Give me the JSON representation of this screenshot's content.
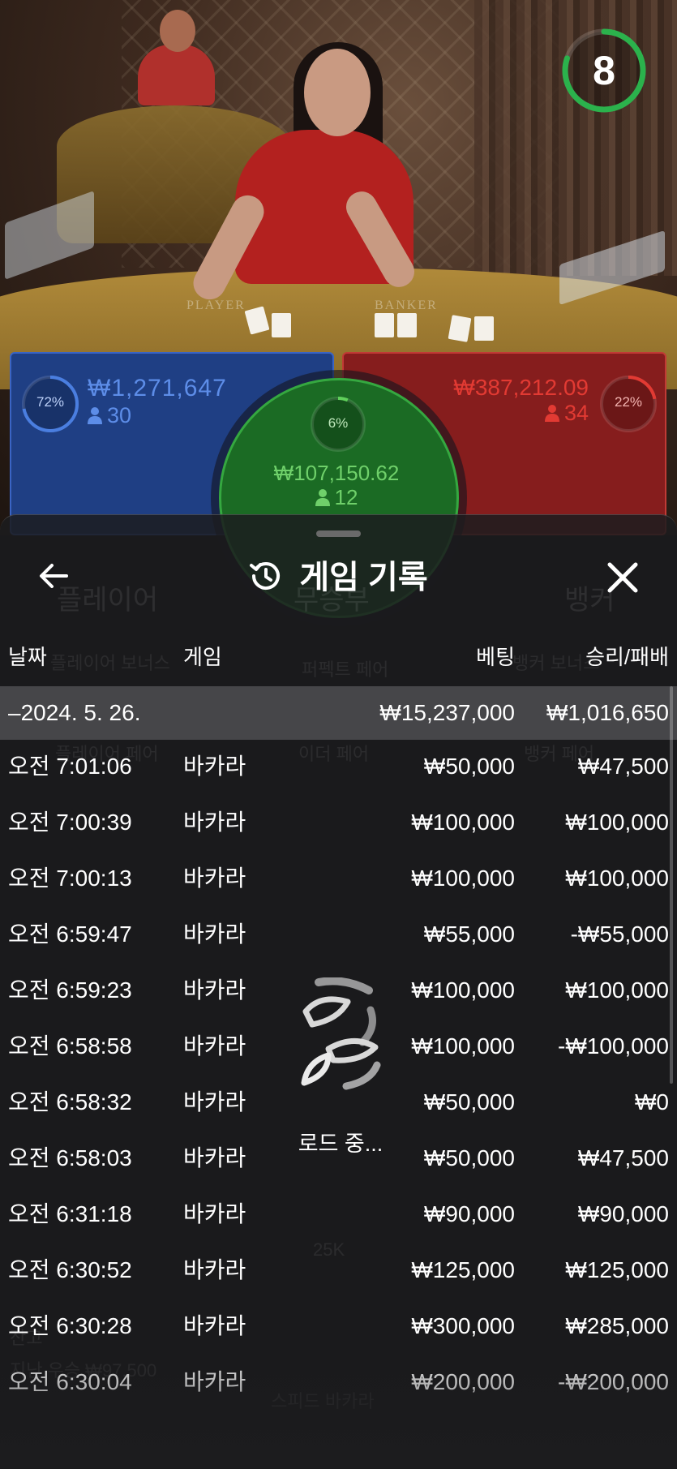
{
  "video": {
    "table_labels": {
      "player": "PLAYER",
      "banker": "BANKER"
    },
    "timer": {
      "value": "8",
      "progress": 0.8,
      "color": "#2bb24c"
    }
  },
  "bets": {
    "player": {
      "percent": "72%",
      "percent_value": 0.72,
      "amount": "₩1,271,647",
      "count": "30",
      "color": "#1f3f84"
    },
    "tie": {
      "percent": "6%",
      "percent_value": 0.06,
      "amount": "₩107,150.62",
      "count": "12",
      "color": "#1b6b24"
    },
    "banker": {
      "percent": "22%",
      "percent_value": 0.22,
      "amount": "₩387,212.09",
      "count": "34",
      "color": "#861d1d"
    }
  },
  "background_ui": {
    "player_tab": "플레이어",
    "banker_tab": "뱅커",
    "tie_tab": "무승부",
    "player_bonus": "플레이어 보너스",
    "perfect_pair": "퍼펙트 페어",
    "either_pair": "이더 페어",
    "player_pair": "플레이어 페어",
    "banker_pair": "뱅커 페어",
    "banker_bonus": "뱅커 보너스",
    "balance": "잔고",
    "last_win": "지난 우승 ₩97,500",
    "speed_baccarat": "스피드 바카라",
    "chip": "25K"
  },
  "panel": {
    "title": "게임 기록",
    "back_icon": "arrow-left-icon",
    "history_icon": "history-icon",
    "close_icon": "close-icon",
    "columns": {
      "date": "날짜",
      "game": "게임",
      "bet": "베팅",
      "winloss": "승리/패배"
    },
    "date_group": {
      "date": "–2024. 5. 26.",
      "bet": "₩15,237,000",
      "winloss": "₩1,016,650"
    },
    "rows": [
      {
        "time": "오전 7:01:06",
        "game": "바카라",
        "bet": "₩50,000",
        "winloss": "₩47,500"
      },
      {
        "time": "오전 7:00:39",
        "game": "바카라",
        "bet": "₩100,000",
        "winloss": "₩100,000"
      },
      {
        "time": "오전 7:00:13",
        "game": "바카라",
        "bet": "₩100,000",
        "winloss": "₩100,000"
      },
      {
        "time": "오전 6:59:47",
        "game": "바카라",
        "bet": "₩55,000",
        "winloss": "-₩55,000"
      },
      {
        "time": "오전 6:59:23",
        "game": "바카라",
        "bet": "₩100,000",
        "winloss": "₩100,000"
      },
      {
        "time": "오전 6:58:58",
        "game": "바카라",
        "bet": "₩100,000",
        "winloss": "-₩100,000"
      },
      {
        "time": "오전 6:58:32",
        "game": "바카라",
        "bet": "₩50,000",
        "winloss": "₩0"
      },
      {
        "time": "오전 6:58:03",
        "game": "바카라",
        "bet": "₩50,000",
        "winloss": "₩47,500"
      },
      {
        "time": "오전 6:31:18",
        "game": "바카라",
        "bet": "₩90,000",
        "winloss": "₩90,000"
      },
      {
        "time": "오전 6:30:52",
        "game": "바카라",
        "bet": "₩125,000",
        "winloss": "₩125,000"
      },
      {
        "time": "오전 6:30:28",
        "game": "바카라",
        "bet": "₩300,000",
        "winloss": "₩285,000"
      },
      {
        "time": "오전 6:30:04",
        "game": "바카라",
        "bet": "₩200,000",
        "winloss": "-₩200,000"
      }
    ],
    "loading": {
      "text": "로드 중...",
      "icon": "loading-spinner-icon"
    }
  }
}
